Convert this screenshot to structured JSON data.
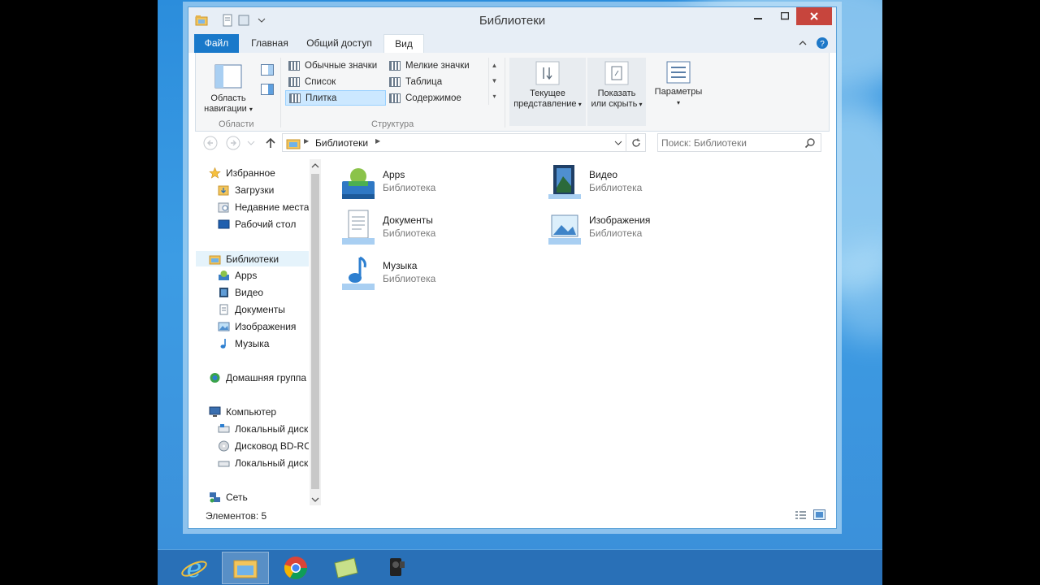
{
  "window": {
    "title": "Библиотеки"
  },
  "ribbon": {
    "tabs": {
      "file": "Файл",
      "home": "Главная",
      "share": "Общий доступ",
      "view": "Вид"
    },
    "nav_pane_button": {
      "line1": "Область",
      "line2": "навигации"
    },
    "group_panes": "Области",
    "layout": {
      "items": [
        "Обычные значки",
        "Мелкие значки",
        "Список",
        "Таблица",
        "Плитка",
        "Содержимое"
      ],
      "selected": "Плитка"
    },
    "group_layout": "Структура",
    "current_view": {
      "line1": "Текущее",
      "line2": "представление"
    },
    "show_hide": {
      "line1": "Показать",
      "line2": "или скрыть"
    },
    "options": "Параметры"
  },
  "address": {
    "path": "Библиотеки"
  },
  "search": {
    "placeholder": "Поиск: Библиотеки"
  },
  "nav": {
    "favorites": "Избранное",
    "fav_items": [
      "Загрузки",
      "Недавние места",
      "Рабочий стол"
    ],
    "libraries": "Библиотеки",
    "lib_items": [
      "Apps",
      "Видео",
      "Документы",
      "Изображения",
      "Музыка"
    ],
    "homegroup": "Домашняя группа",
    "computer": "Компьютер",
    "comp_items": [
      "Локальный диск",
      "Дисковод BD-ROM",
      "Локальный диск"
    ],
    "network": "Сеть"
  },
  "tiles": [
    {
      "name": "Apps",
      "sub": "Библиотека",
      "icon": "apps-library-icon"
    },
    {
      "name": "Видео",
      "sub": "Библиотека",
      "icon": "video-library-icon"
    },
    {
      "name": "Документы",
      "sub": "Библиотека",
      "icon": "documents-library-icon"
    },
    {
      "name": "Изображения",
      "sub": "Библиотека",
      "icon": "pictures-library-icon"
    },
    {
      "name": "Музыка",
      "sub": "Библиотека",
      "icon": "music-library-icon"
    }
  ],
  "status": {
    "count": "Элементов: 5"
  },
  "taskbar": [
    "internet-explorer-icon",
    "file-explorer-icon",
    "chrome-icon",
    "notes-app-icon",
    "camcorder-app-icon"
  ],
  "colors": {
    "file_tab": "#1979ca",
    "close_button": "#c7453d",
    "selected_layout": "#cce8ff"
  }
}
